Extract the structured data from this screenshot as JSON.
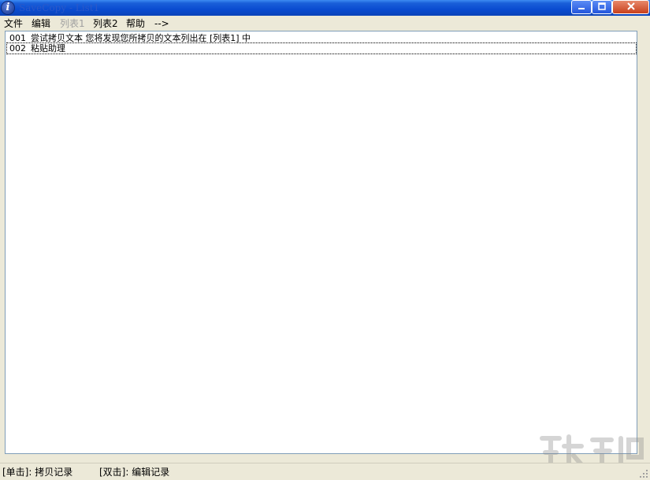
{
  "window": {
    "title": "SaveCopy - List1",
    "app_icon": "info-i-icon",
    "controls": [
      "minimize-icon",
      "maximize-icon",
      "close-icon"
    ]
  },
  "menu": {
    "items": [
      {
        "label": "文件",
        "enabled": true
      },
      {
        "label": "编辑",
        "enabled": true
      },
      {
        "label": "列表1",
        "enabled": false
      },
      {
        "label": "列表2",
        "enabled": true
      },
      {
        "label": "帮助",
        "enabled": true
      },
      {
        "label": "-->",
        "enabled": true
      }
    ]
  },
  "list": {
    "rows": [
      {
        "num": "001",
        "text": "尝试拷贝文本 您将发现您所拷贝的文本列出在 [列表1] 中"
      },
      {
        "num": "002",
        "text": "粘贴助理"
      }
    ],
    "focused_row": 1
  },
  "status": {
    "left": "[单击]: 拷贝记录",
    "right": "[双击]: 编辑记录"
  }
}
